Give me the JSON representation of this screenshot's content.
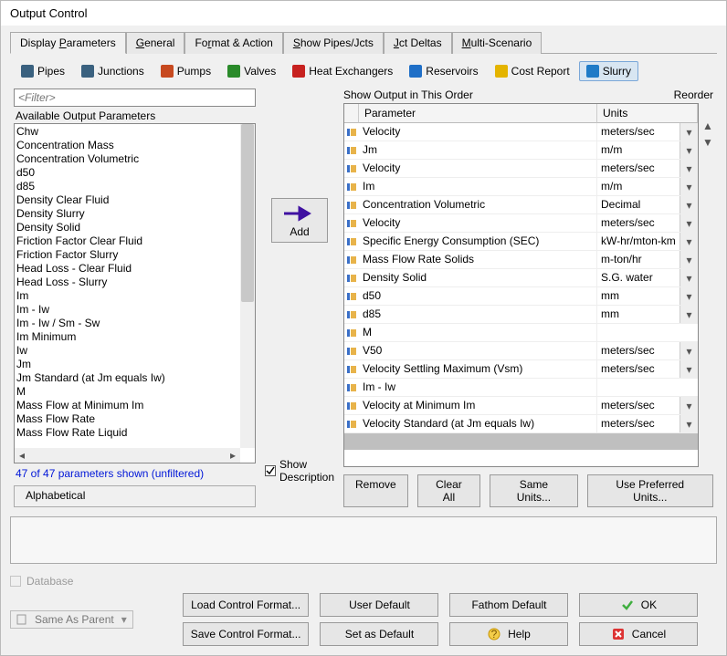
{
  "window_title": "Output Control",
  "main_tabs": [
    {
      "pre": "Display ",
      "u": "P",
      "post": "arameters",
      "active": true
    },
    {
      "pre": "",
      "u": "G",
      "post": "eneral"
    },
    {
      "pre": "Fo",
      "u": "r",
      "post": "mat & Action"
    },
    {
      "pre": "",
      "u": "S",
      "post": "how Pipes/Jcts"
    },
    {
      "pre": "",
      "u": "J",
      "post": "ct Deltas"
    },
    {
      "pre": "",
      "u": "M",
      "post": "ulti-Scenario"
    }
  ],
  "toolbar": [
    {
      "label": "Pipes",
      "icon": "#3a617f",
      "name": "pipes"
    },
    {
      "label": "Junctions",
      "icon": "#3a617f",
      "name": "junctions"
    },
    {
      "label": "Pumps",
      "icon": "#c7491f",
      "name": "pumps"
    },
    {
      "label": "Valves",
      "icon": "#2a8a2a",
      "name": "valves"
    },
    {
      "label": "Heat Exchangers",
      "icon": "#c7211f",
      "name": "heat-exchangers"
    },
    {
      "label": "Reservoirs",
      "icon": "#1f6fc7",
      "name": "reservoirs"
    },
    {
      "label": "Cost Report",
      "icon": "#e4b400",
      "name": "cost-report"
    },
    {
      "label": "Slurry",
      "icon": "#1f7bc7",
      "name": "slurry",
      "active": true
    }
  ],
  "filter_placeholder": "<Filter>",
  "available_label": "Available Output Parameters",
  "available_items": [
    "Chw",
    "Concentration Mass",
    "Concentration Volumetric",
    "d50",
    "d85",
    "Density Clear Fluid",
    "Density Slurry",
    "Density Solid",
    "Friction Factor Clear Fluid",
    "Friction Factor Slurry",
    "Head Loss - Clear Fluid",
    "Head Loss - Slurry",
    "Im",
    "Im - Iw",
    "Im - Iw / Sm - Sw",
    "Im Minimum",
    "Iw",
    "Jm",
    "Jm Standard (at Jm equals Iw)",
    "M",
    "Mass Flow at Minimum Im",
    "Mass Flow Rate",
    "Mass Flow Rate Liquid"
  ],
  "count_text": "47 of 47 parameters shown (unfiltered)",
  "alphabetical": "Alphabetical",
  "add_label": "Add",
  "show_output_label": "Show Output in This Order",
  "reorder_label": "Reorder",
  "th_param": "Parameter",
  "th_units": "Units",
  "output_rows": [
    {
      "p": "Velocity",
      "u": "meters/sec",
      "dd": true
    },
    {
      "p": "Jm",
      "u": "m/m",
      "dd": true
    },
    {
      "p": "Velocity",
      "u": "meters/sec",
      "dd": true
    },
    {
      "p": "Im",
      "u": "m/m",
      "dd": true
    },
    {
      "p": "Concentration Volumetric",
      "u": "Decimal",
      "dd": true
    },
    {
      "p": "Velocity",
      "u": "meters/sec",
      "dd": true
    },
    {
      "p": "Specific Energy Consumption (SEC)",
      "u": "kW-hr/mton-km",
      "dd": true
    },
    {
      "p": "Mass Flow Rate Solids",
      "u": "m-ton/hr",
      "dd": true
    },
    {
      "p": "Density Solid",
      "u": "S.G. water",
      "dd": true
    },
    {
      "p": "d50",
      "u": "mm",
      "dd": true
    },
    {
      "p": "d85",
      "u": "mm",
      "dd": true
    },
    {
      "p": "M",
      "u": "",
      "dd": false
    },
    {
      "p": "V50",
      "u": "meters/sec",
      "dd": true
    },
    {
      "p": "Velocity Settling Maximum (Vsm)",
      "u": "meters/sec",
      "dd": true
    },
    {
      "p": "Im - Iw",
      "u": "",
      "dd": false
    },
    {
      "p": "Velocity at Minimum Im",
      "u": "meters/sec",
      "dd": true
    },
    {
      "p": "Velocity Standard (at Jm equals Iw)",
      "u": "meters/sec",
      "dd": true
    }
  ],
  "showdesc_label1": "Show",
  "showdesc_label2": "Description",
  "right_buttons": {
    "remove": "Remove",
    "clear": "Clear All",
    "same": "Same Units...",
    "pref": "Use Preferred Units..."
  },
  "database_label": "Database",
  "same_as_parent": "Same As Parent",
  "bottom_buttons": {
    "load": "Load Control Format...",
    "save": "Save Control Format...",
    "user": "User Default",
    "setdef": "Set as Default",
    "fathom": "Fathom Default",
    "help": "Help",
    "ok": "OK",
    "cancel": "Cancel"
  }
}
